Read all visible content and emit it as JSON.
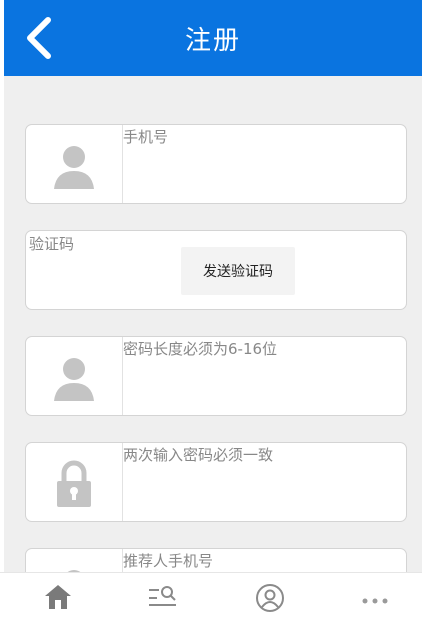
{
  "header": {
    "title": "注册",
    "back_icon": "chevron-left-icon"
  },
  "form": {
    "phone": {
      "placeholder": "手机号",
      "icon": "user-icon"
    },
    "verification_code": {
      "placeholder": "验证码",
      "send_button_label": "发送验证码"
    },
    "password": {
      "placeholder": "密码长度必须为6-16位",
      "icon": "user-icon"
    },
    "confirm_password": {
      "placeholder": "两次输入密码必须一致",
      "icon": "lock-icon"
    },
    "referrer_phone": {
      "placeholder": "推荐人手机号",
      "icon": "user-icon"
    }
  },
  "bottom_nav": [
    {
      "icon": "home-icon"
    },
    {
      "icon": "search-list-icon"
    },
    {
      "icon": "user-circle-icon"
    },
    {
      "icon": "more-icon"
    }
  ],
  "colors": {
    "header_bg": "#0a74e0",
    "content_bg": "#efefef",
    "icon_gray": "#c4c4c4"
  }
}
